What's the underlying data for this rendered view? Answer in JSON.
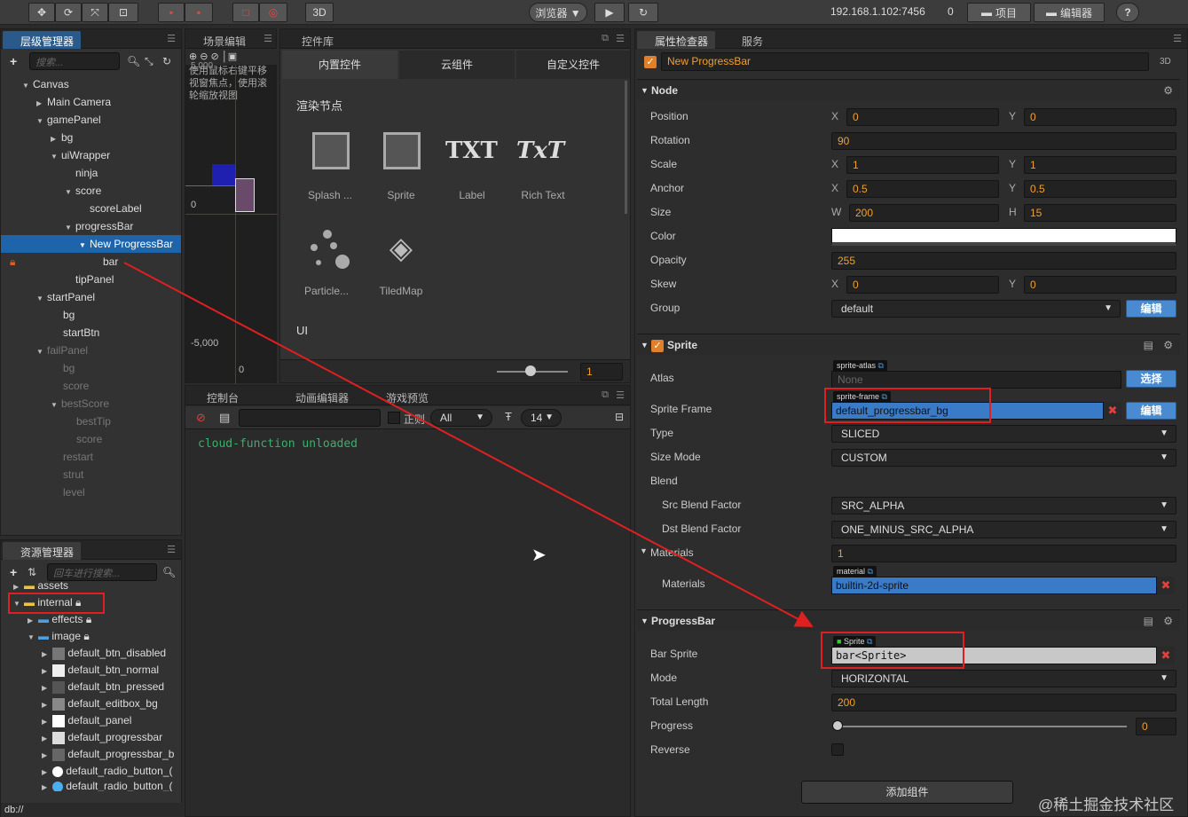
{
  "toolbar": {
    "mode_3d": "3D",
    "browser_label": "浏览器 ▼",
    "ip": "192.168.1.102:7456",
    "count": "0",
    "project_label": "项目",
    "editor_label": "编辑器",
    "help": "?"
  },
  "hierarchy": {
    "tab": "层级管理器",
    "search_placeholder": "搜索...",
    "items": [
      {
        "label": "Canvas"
      },
      {
        "label": "Main Camera"
      },
      {
        "label": "gamePanel"
      },
      {
        "label": "bg"
      },
      {
        "label": "uiWrapper"
      },
      {
        "label": "ninja"
      },
      {
        "label": "score"
      },
      {
        "label": "scoreLabel"
      },
      {
        "label": "progressBar"
      },
      {
        "label": "New ProgressBar"
      },
      {
        "label": "bar"
      },
      {
        "label": "tipPanel"
      },
      {
        "label": "startPanel"
      },
      {
        "label": "bg"
      },
      {
        "label": "startBtn"
      },
      {
        "label": "failPanel"
      },
      {
        "label": "bg"
      },
      {
        "label": "score"
      },
      {
        "label": "bestScore"
      },
      {
        "label": "bestTip"
      },
      {
        "label": "score"
      },
      {
        "label": "restart"
      },
      {
        "label": "strut"
      },
      {
        "label": "level"
      }
    ]
  },
  "scene": {
    "tab": "场景编辑",
    "hint": "使用鼠标右键平移视窗焦点，使用滚轮缩放视图",
    "label_top": "5,000",
    "label_zero": "0",
    "label_neg": "-5,000",
    "label_x0": "0"
  },
  "controls": {
    "tab": "控件库",
    "tabs": [
      "内置控件",
      "云组件",
      "自定义控件"
    ],
    "group_render": "渲染节点",
    "items": [
      "Splash ...",
      "Sprite",
      "Label",
      "Rich Text",
      "Particle...",
      "TiledMap"
    ],
    "txt1": "TXT",
    "txt2": "TxT",
    "group_ui": "UI",
    "zoom_value": "1"
  },
  "console": {
    "tabs": [
      "控制台",
      "动画编辑器",
      "游戏预览"
    ],
    "regex_label": "正则",
    "filter": "All",
    "font_size": "14",
    "log": "cloud-function unloaded"
  },
  "assets": {
    "tab": "资源管理器",
    "search_placeholder": "回车进行搜索...",
    "items": [
      {
        "label": "assets"
      },
      {
        "label": "internal"
      },
      {
        "label": "effects"
      },
      {
        "label": "image"
      },
      {
        "label": "default_btn_disabled"
      },
      {
        "label": "default_btn_normal"
      },
      {
        "label": "default_btn_pressed"
      },
      {
        "label": "default_editbox_bg"
      },
      {
        "label": "default_panel"
      },
      {
        "label": "default_progressbar"
      },
      {
        "label": "default_progressbar_b"
      },
      {
        "label": "default_radio_button_("
      },
      {
        "label": "default_radio_button_("
      }
    ],
    "status": "db://"
  },
  "inspector": {
    "tabs": [
      "属性检查器",
      "服务"
    ],
    "node_name": "New ProgressBar",
    "mode_3d": "3D",
    "node_section": "Node",
    "position_label": "Position",
    "pos_x": "0",
    "pos_y": "0",
    "rotation_label": "Rotation",
    "rotation": "90",
    "scale_label": "Scale",
    "scale_x": "1",
    "scale_y": "1",
    "anchor_label": "Anchor",
    "anchor_x": "0.5",
    "anchor_y": "0.5",
    "size_label": "Size",
    "size_w": "200",
    "size_h": "15",
    "color_label": "Color",
    "opacity_label": "Opacity",
    "opacity": "255",
    "skew_label": "Skew",
    "skew_x": "0",
    "skew_y": "0",
    "group_label": "Group",
    "group": "default",
    "edit_btn": "编辑",
    "sprite_section": "Sprite",
    "atlas_label": "Atlas",
    "atlas_tag": "sprite-atlas",
    "atlas_value": "None",
    "select_btn": "选择",
    "frame_label": "Sprite Frame",
    "frame_tag": "sprite-frame",
    "frame_value": "default_progressbar_bg",
    "type_label": "Type",
    "type": "SLICED",
    "sizemode_label": "Size Mode",
    "sizemode": "CUSTOM",
    "blend_label": "Blend",
    "src_label": "Src Blend Factor",
    "src": "SRC_ALPHA",
    "dst_label": "Dst Blend Factor",
    "dst": "ONE_MINUS_SRC_ALPHA",
    "materials_label": "Materials",
    "materials_count": "1",
    "materials_sub": "Materials",
    "material_tag": "material",
    "material_value": "builtin-2d-sprite",
    "progress_section": "ProgressBar",
    "barsprite_label": "Bar Sprite",
    "barsprite_tag": "Sprite",
    "barsprite_value": "bar<Sprite>",
    "mode_label": "Mode",
    "mode": "HORIZONTAL",
    "length_label": "Total Length",
    "length": "200",
    "progress_label": "Progress",
    "progress": "0",
    "reverse_label": "Reverse",
    "add_component": "添加组件"
  },
  "watermark": "@稀土掘金技术社区"
}
